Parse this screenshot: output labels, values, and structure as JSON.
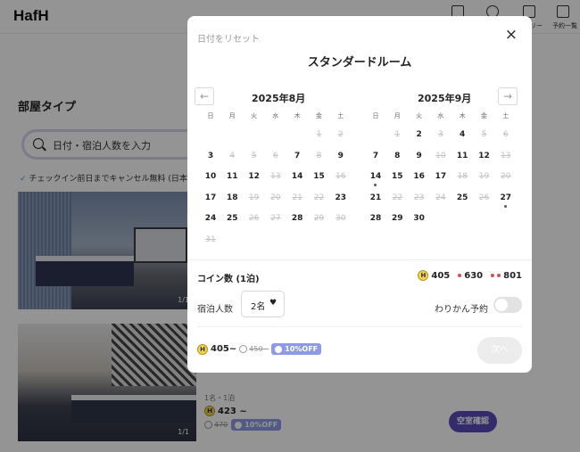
{
  "app": {
    "logo": "HafH"
  },
  "header": {
    "items": [
      {
        "icon": "bed-icon",
        "label": ""
      },
      {
        "icon": "plane-icon",
        "label": ""
      },
      {
        "icon": "passport-icon",
        "label": "リー"
      },
      {
        "icon": "calendar-icon",
        "label": "予約一覧"
      }
    ]
  },
  "page": {
    "section_title": "部屋タイプ",
    "search_placeholder": "日付・宿泊人数を入力",
    "cancel_note": "チェックイン前日までキャンセル無料 (日本時",
    "photo_counter_1": "1/1",
    "photo_counter_2": "1/1",
    "card2": {
      "guests": "1名・1泊",
      "price": "423 ~",
      "old_price": "470",
      "discount": "10%OFF",
      "button": "空室確認"
    }
  },
  "modal": {
    "reset": "日付をリセット",
    "close": "×",
    "title": "スタンダードルーム",
    "prev": "←",
    "next": "→",
    "weekdays": [
      "日",
      "月",
      "火",
      "水",
      "木",
      "金",
      "土"
    ],
    "months": [
      {
        "title": "2025年8月",
        "cells": [
          [
            null,
            null,
            null,
            null,
            null,
            "1",
            "2"
          ],
          [
            "3",
            "4",
            "5",
            "6",
            "7",
            "8",
            "9"
          ],
          [
            "10",
            "11",
            "12",
            "13",
            "14",
            "15",
            "16"
          ],
          [
            "17",
            "18",
            "19",
            "20",
            "21",
            "22",
            "23"
          ],
          [
            "24",
            "25",
            "26",
            "27",
            "28",
            "29",
            "30"
          ],
          [
            "31",
            null,
            null,
            null,
            null,
            null,
            null
          ]
        ],
        "disabled": [
          "1",
          "2",
          "4",
          "5",
          "6",
          "8",
          "13",
          "16",
          "19",
          "20",
          "21",
          "22",
          "26",
          "27",
          "29",
          "30",
          "31"
        ],
        "dotted": []
      },
      {
        "title": "2025年9月",
        "cells": [
          [
            null,
            "1",
            "2",
            "3",
            "4",
            "5",
            "6"
          ],
          [
            "7",
            "8",
            "9",
            "10",
            "11",
            "12",
            "13"
          ],
          [
            "14",
            "15",
            "16",
            "17",
            "18",
            "19",
            "20"
          ],
          [
            "21",
            "22",
            "23",
            "24",
            "25",
            "26",
            "27"
          ],
          [
            "28",
            "29",
            "30",
            null,
            null,
            null,
            null
          ]
        ],
        "disabled": [
          "1",
          "3",
          "5",
          "6",
          "10",
          "13",
          "18",
          "19",
          "20",
          "22",
          "23",
          "24",
          "26"
        ],
        "dotted": [
          "14",
          "27"
        ]
      }
    ],
    "coin_label": "コイン数 (1泊)",
    "coins": {
      "c1": "405",
      "c2": "630",
      "c3": "801"
    },
    "guest_label": "宿泊人数",
    "guest_value": "2名",
    "wake_label": "わりかん予約",
    "wake_on": false,
    "price": "405~",
    "old_price": "450~",
    "discount": "10%OFF",
    "next_button": "次へ"
  },
  "colors": {
    "accent": "#5a4bb7",
    "coin": "#f3d45a",
    "discount": "#8f9ae6"
  }
}
